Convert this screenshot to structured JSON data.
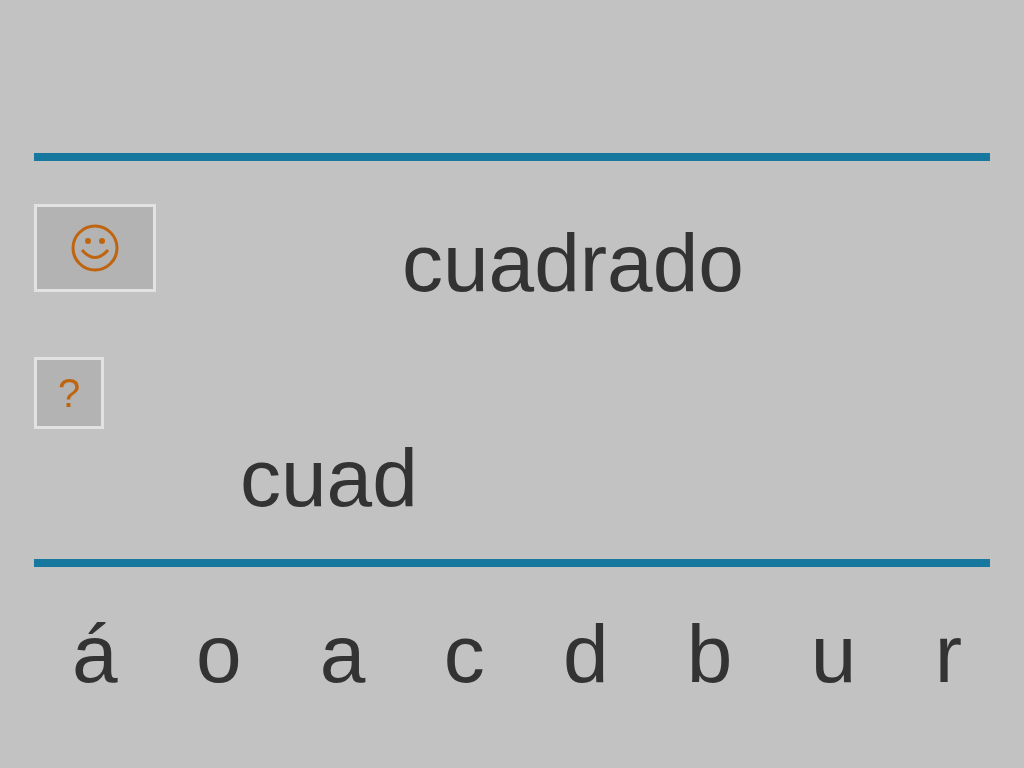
{
  "target_word": "cuadrado",
  "hint_button": {
    "label": "?"
  },
  "answer": "cuad",
  "letters": [
    "á",
    "o",
    "a",
    "c",
    "d",
    "b",
    "u",
    "r"
  ]
}
